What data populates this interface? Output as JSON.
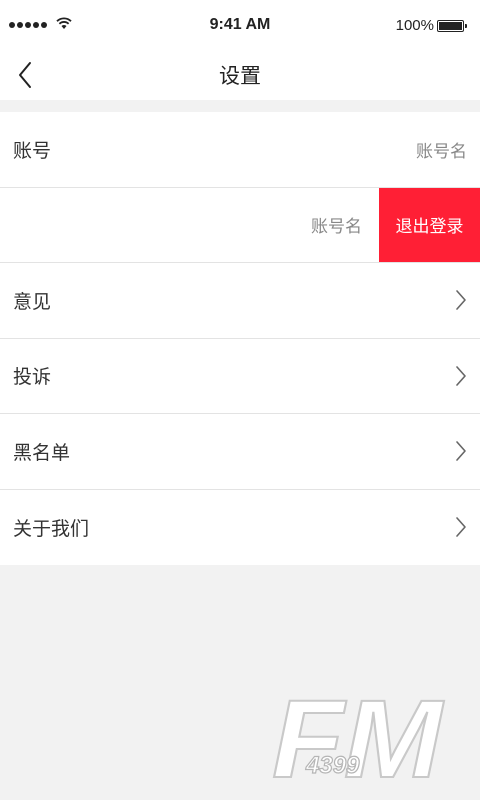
{
  "status_bar": {
    "time": "9:41 AM",
    "battery": "100%"
  },
  "nav": {
    "title": "设置",
    "back_icon": "chevron-left-icon"
  },
  "rows": [
    {
      "label": "账号",
      "value": "账号名"
    },
    {
      "value": "账号名",
      "action": "退出登录"
    },
    {
      "label": "意见"
    },
    {
      "label": "投诉"
    },
    {
      "label": "黑名单"
    },
    {
      "label": "关于我们"
    }
  ],
  "watermark": {
    "text_main": "FM",
    "text_sub": "4399"
  },
  "colors": {
    "accent": "#ff1f35",
    "background": "#f2f2f2"
  }
}
